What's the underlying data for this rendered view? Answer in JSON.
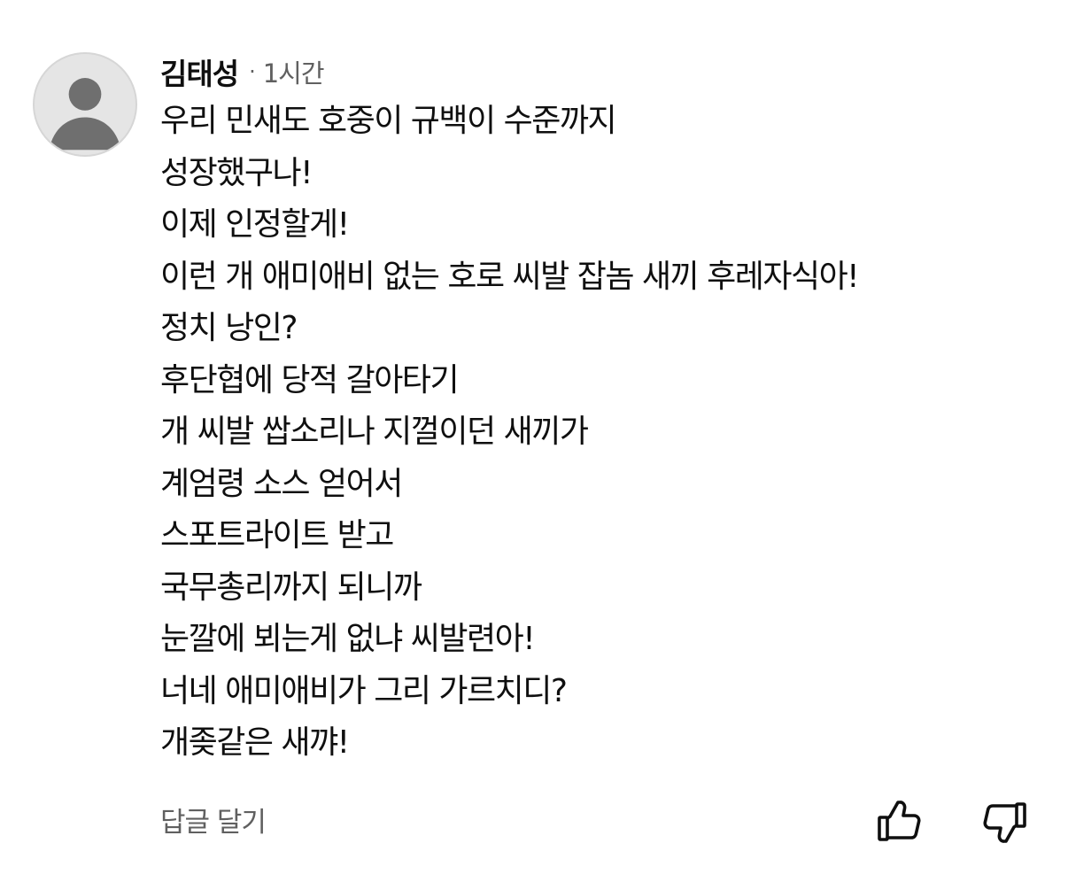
{
  "comment": {
    "author": "김태성",
    "separator": "·",
    "time": "1시간",
    "avatar_icon": "default-user-avatar-icon",
    "lines": [
      "우리 민새도 호중이 규백이 수준까지",
      "성장했구나!",
      "이제 인정할게!",
      "이런 개 애미애비 없는 호로 씨발 잡놈 새끼 후레자식아!",
      "정치 낭인?",
      "후단협에 당적 갈아타기",
      "개 씨발 쌉소리나 지껄이던 새끼가",
      "계엄령 소스 얻어서",
      "스포트라이트 받고",
      "국무총리까지 되니까",
      "눈깔에 뵈는게 없냐 씨발련아!",
      "너네 애미애비가 그리 가르치디?",
      "개좆같은 새꺄!"
    ],
    "reply_label": "답글 달기",
    "like_icon": "thumbs-up-icon",
    "dislike_icon": "thumbs-down-icon"
  },
  "colors": {
    "text_primary": "#0f0f0f",
    "text_secondary": "#606060",
    "avatar_bg": "#e5e5e5",
    "avatar_figure": "#6f6f6f"
  }
}
